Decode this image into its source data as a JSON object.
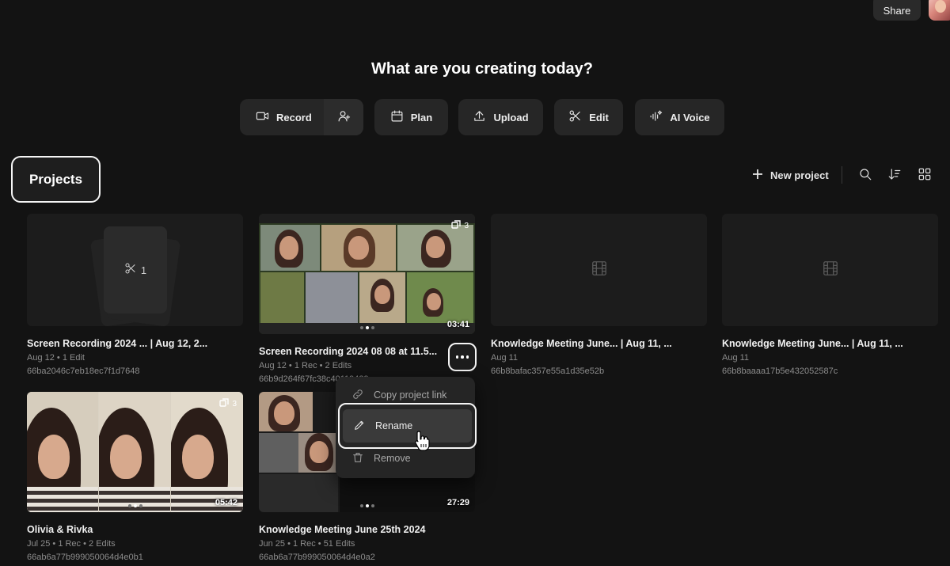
{
  "header": {
    "share_label": "Share"
  },
  "hero": {
    "title": "What are you creating today?",
    "actions": [
      {
        "label": "Record",
        "icon": "video-camera-icon"
      },
      {
        "label": "Plan",
        "icon": "calendar-icon"
      },
      {
        "label": "Upload",
        "icon": "upload-icon"
      },
      {
        "label": "Edit",
        "icon": "scissors-icon"
      },
      {
        "label": "AI Voice",
        "icon": "ai-voice-icon"
      }
    ],
    "invite_icon": "add-user-icon"
  },
  "projects": {
    "tab_label": "Projects",
    "new_project_label": "New project",
    "tools": [
      "search-icon",
      "sort-icon",
      "grid-view-icon"
    ],
    "cards": [
      {
        "title": "Screen Recording 2024 ... | Aug 12, 2...",
        "meta": "Aug 12 • 1 Edit",
        "id": "66ba2046c7eb18ec7f1d7648",
        "edit_count": "1"
      },
      {
        "title": "Screen Recording 2024 08 08 at 11.5...",
        "meta": "Aug 12 • 1 Rec • 2 Edits",
        "id": "66b9d264f67fc38c40119429",
        "duration": "03:41",
        "clips": "3"
      },
      {
        "title": "Knowledge Meeting June... | Aug 11, ...",
        "meta": "Aug 11",
        "id": "66b8bafac357e55a1d35e52b"
      },
      {
        "title": "Knowledge Meeting June... | Aug 11, ...",
        "meta": "Aug 11",
        "id": "66b8baaaa17b5e432052587c"
      },
      {
        "title": "Olivia & Rivka",
        "meta": "Jul 25 • 1 Rec • 2 Edits",
        "id": "66ab6a77b999050064d4e0b1",
        "duration": "05:42",
        "clips": "3"
      },
      {
        "title": "Knowledge Meeting June 25th 2024",
        "meta": "Jun 25 • 1 Rec • 51 Edits",
        "id": "66ab6a77b999050064d4e0a2",
        "duration": "27:29"
      }
    ]
  },
  "context_menu": {
    "items": [
      {
        "label": "Copy project link",
        "icon": "link-icon"
      },
      {
        "label": "Rename",
        "icon": "pencil-icon"
      },
      {
        "label": "Remove",
        "icon": "trash-icon"
      }
    ]
  }
}
